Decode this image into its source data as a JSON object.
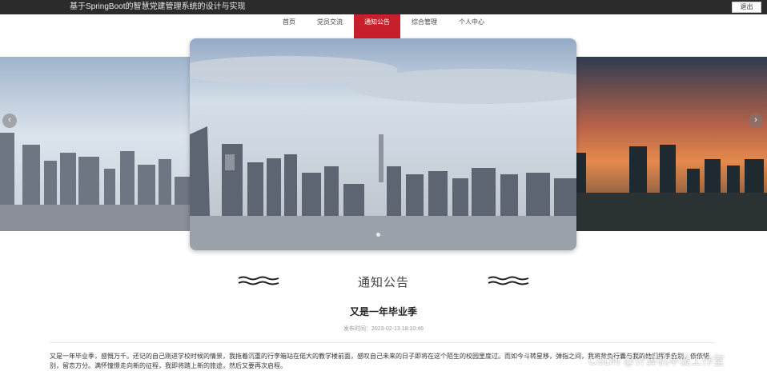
{
  "header": {
    "site_title": "基于SpringBoot的智慧党建管理系统的设计与实现",
    "logout_label": "退出"
  },
  "nav": {
    "items": [
      {
        "label": "首页"
      },
      {
        "label": "党员交流"
      },
      {
        "label": "通知公告"
      },
      {
        "label": "综合管理"
      },
      {
        "label": "个人中心"
      }
    ],
    "active_index": 2
  },
  "carousel": {
    "prev_icon": "chevron-left-icon",
    "next_icon": "chevron-right-icon",
    "prev_glyph": "‹",
    "next_glyph": "›"
  },
  "section": {
    "title": "通知公告"
  },
  "post": {
    "title": "又是一年毕业季",
    "time": "发布时间：2023-02-13 18:10:46",
    "content": "又是一年毕业季，感慨万千。还记的自己刚进学校时候的情景，我拖着沉重的行李箱站在偌大的教学楼前面，感叹自己未来的日子即将在这个陌生的校园里度过。而如今斗转星移，弹指之间，我将背负行囊与我的她们挥手告别，依依惜别，留恋万分。满怀憧憬走向新的征程，我即将踏上新的旅途，然后又要再次启程。"
  },
  "watermark": "CSDN @计算机毕设工作室",
  "colors": {
    "topbar": "#2b2b2b",
    "accent": "#c8202b"
  }
}
